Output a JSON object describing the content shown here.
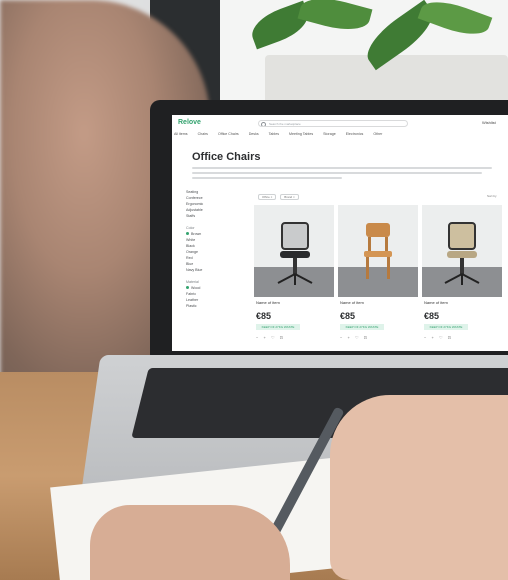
{
  "site": {
    "logo": "Relove",
    "search_placeholder": "Search the marketplace",
    "wishlist": "Wishlist",
    "nav": [
      "All items",
      "Chairs",
      "Office Chairs",
      "Desks",
      "Tables",
      "Meeting Tables",
      "Storage",
      "Electronics",
      "Other"
    ]
  },
  "page": {
    "title": "Office Chairs"
  },
  "sidebar": {
    "items": [
      "Seating",
      "Conferece",
      "Ergonomic",
      "Adjustable",
      "Staffs"
    ],
    "color_heading": "Color",
    "colors": [
      "Brown",
      "White",
      "Black",
      "Orange",
      "Red",
      "Blue",
      "Navy Blue"
    ],
    "material_heading": "Material",
    "materials": [
      "Wood",
      "Fabric",
      "Leather",
      "Plastic"
    ]
  },
  "filters": {
    "chips": [
      "Office ×",
      "Brand ×"
    ],
    "sort": "Sort by"
  },
  "products": [
    {
      "name": "Name of item",
      "price": "€85",
      "badge": "KEEP OF 27KG WASTE"
    },
    {
      "name": "Name of item",
      "price": "€85",
      "badge": "KEEP OF 27KG WASTE"
    },
    {
      "name": "Name of item",
      "price": "€85",
      "badge": "KEEP OF 27KG WASTE"
    }
  ],
  "colors": {
    "brand": "#34a36f",
    "text": "#2d2f31"
  }
}
